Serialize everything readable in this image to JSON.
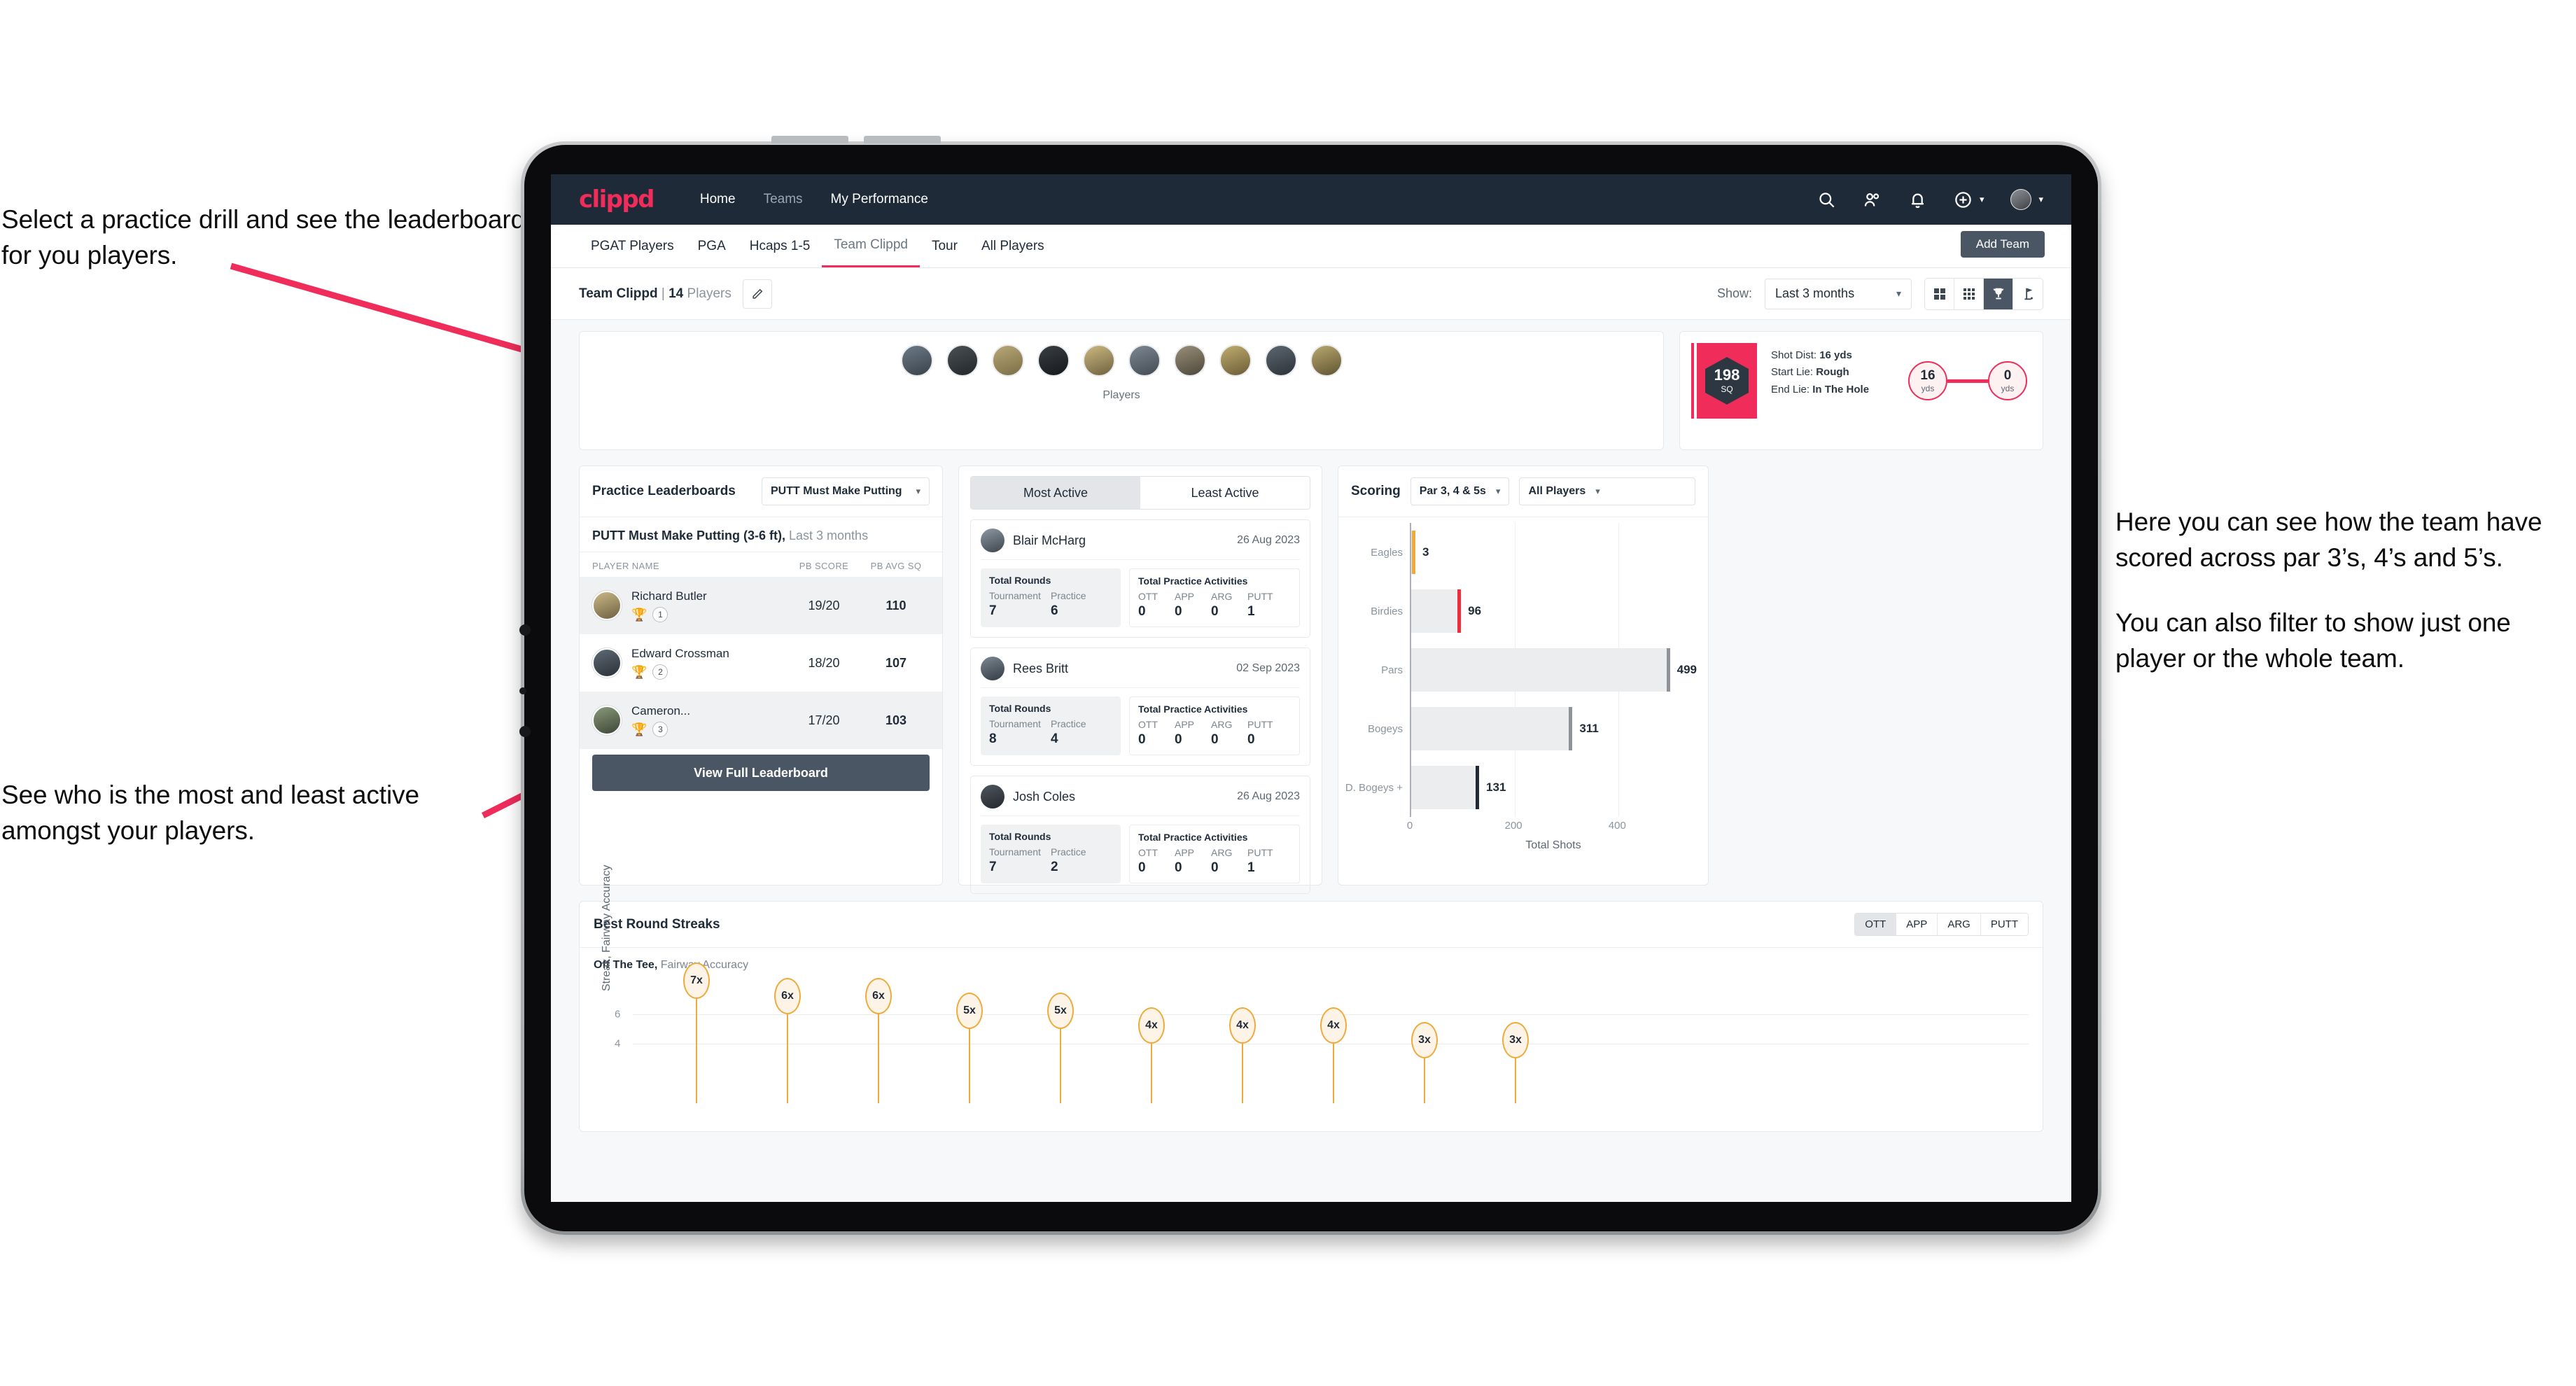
{
  "annotations": {
    "top_left": "Select a practice drill and see the leaderboard for you players.",
    "bottom_left": "See who is the most and least active amongst your players.",
    "right_1": "Here you can see how the team have scored across par 3’s, 4’s and 5’s.",
    "right_2": "You can also filter to show just one player or the whole team.",
    "arrow_color": "#ef2c5a"
  },
  "navbar": {
    "logo": "clippd",
    "links": [
      {
        "label": "Home",
        "active": true
      },
      {
        "label": "Teams",
        "active": false
      },
      {
        "label": "My Performance",
        "active": true
      }
    ],
    "icons": [
      "search-icon",
      "people-icon",
      "bell-icon",
      "plus-circle-icon",
      "avatar"
    ]
  },
  "tabbar": {
    "tabs": [
      {
        "label": "PGAT Players",
        "active": false
      },
      {
        "label": "PGA",
        "active": false
      },
      {
        "label": "Hcaps 1-5",
        "active": false
      },
      {
        "label": "Team Clippd",
        "active": true
      },
      {
        "label": "Tour",
        "active": false
      },
      {
        "label": "All Players",
        "active": false
      }
    ],
    "add_team_label": "Add Team"
  },
  "subheader": {
    "team_name": "Team Clippd",
    "separator": " | ",
    "player_count": "14",
    "players_word": " Players",
    "edit_icon": "pencil-icon",
    "show_label": "Show:",
    "show_value": "Last 3 months",
    "view_buttons": [
      {
        "name": "grid-large-icon",
        "active": false
      },
      {
        "name": "grid-small-icon",
        "active": false
      },
      {
        "name": "trophy-icon",
        "active": true
      },
      {
        "name": "golf-flag-icon",
        "active": false
      }
    ]
  },
  "players_strip": {
    "caption": "Players",
    "avatar_count": 10
  },
  "shot_card": {
    "sq_value": "198",
    "sq_unit": "SQ",
    "lines": [
      {
        "label": "Shot Dist:",
        "value": "16 yds"
      },
      {
        "label": "Start Lie:",
        "value": "Rough"
      },
      {
        "label": "End Lie:",
        "value": "In The Hole"
      }
    ],
    "start_yds": "16",
    "start_unit": "yds",
    "end_yds": "0",
    "end_unit": "yds"
  },
  "practice_leaderboard": {
    "title": "Practice Leaderboards",
    "drill_select": "PUTT Must Make Putting ...",
    "subtitle_bold": "PUTT Must Make Putting (3-6 ft),",
    "subtitle_grey": " Last 3 months",
    "columns": [
      "PLAYER NAME",
      "PB SCORE",
      "PB AVG SQ"
    ],
    "rows": [
      {
        "name": "Richard Butler",
        "rank": "1",
        "trophy": "gold",
        "pb_score": "19/20",
        "pb_avg_sq": "110"
      },
      {
        "name": "Edward Crossman",
        "rank": "2",
        "trophy": "silver",
        "pb_score": "18/20",
        "pb_avg_sq": "107"
      },
      {
        "name": "Cameron...",
        "rank": "3",
        "trophy": "bronze",
        "pb_score": "17/20",
        "pb_avg_sq": "103"
      }
    ],
    "button_label": "View Full Leaderboard"
  },
  "activity_panel": {
    "tabs": [
      {
        "label": "Most Active",
        "active": true
      },
      {
        "label": "Least Active",
        "active": false
      }
    ],
    "rounds_title": "Total Rounds",
    "activities_title": "Total Practice Activities",
    "rounds_keys": [
      "Tournament",
      "Practice"
    ],
    "activity_keys": [
      "OTT",
      "APP",
      "ARG",
      "PUTT"
    ],
    "players": [
      {
        "name": "Blair McHarg",
        "date": "26 Aug 2023",
        "tournament": "7",
        "practice": "6",
        "ott": "0",
        "app": "0",
        "arg": "0",
        "putt": "1"
      },
      {
        "name": "Rees Britt",
        "date": "02 Sep 2023",
        "tournament": "8",
        "practice": "4",
        "ott": "0",
        "app": "0",
        "arg": "0",
        "putt": "0"
      },
      {
        "name": "Josh Coles",
        "date": "26 Aug 2023",
        "tournament": "7",
        "practice": "2",
        "ott": "0",
        "app": "0",
        "arg": "0",
        "putt": "1"
      }
    ]
  },
  "scoring_panel": {
    "title": "Scoring",
    "par_select": "Par 3, 4 & 5s",
    "players_select": "All Players"
  },
  "streaks_panel": {
    "title": "Best Round Streaks",
    "toggle": [
      {
        "label": "OTT",
        "active": true
      },
      {
        "label": "APP",
        "active": false
      },
      {
        "label": "ARG",
        "active": false
      },
      {
        "label": "PUTT",
        "active": false
      }
    ],
    "subtitle_bold": "Off The Tee,",
    "subtitle_grey": " Fairway Accuracy"
  },
  "chart_data": [
    {
      "type": "bar",
      "orientation": "horizontal",
      "title": "Scoring",
      "categories": [
        "Eagles",
        "Birdies",
        "Pars",
        "Bogeys",
        "D. Bogeys +"
      ],
      "values": [
        3,
        96,
        499,
        311,
        131
      ],
      "cap_colors": [
        "#eeab3c",
        "#ef2c3c",
        "#8d9399",
        "#8d9399",
        "#222b33"
      ],
      "xlabel": "Total Shots",
      "ylabel": "",
      "xlim": [
        0,
        540
      ],
      "xticks": [
        0,
        200,
        400
      ],
      "grid": true,
      "legend": "none"
    },
    {
      "type": "scatter",
      "title": "Best Round Streaks",
      "subtitle": "Off The Tee, Fairway Accuracy",
      "ylabel": "Streak, Fairway Accuracy",
      "ylim": [
        0,
        8
      ],
      "yticks": [
        4,
        6
      ],
      "labels": [
        "7x",
        "6x",
        "6x",
        "5x",
        "5x",
        "4x",
        "4x",
        "4x",
        "3x",
        "3x"
      ],
      "values": [
        7,
        6,
        6,
        5,
        5,
        4,
        4,
        4,
        3,
        3
      ],
      "marker": "ellipse-pin",
      "color": "#eeab3c",
      "grid": true
    }
  ]
}
